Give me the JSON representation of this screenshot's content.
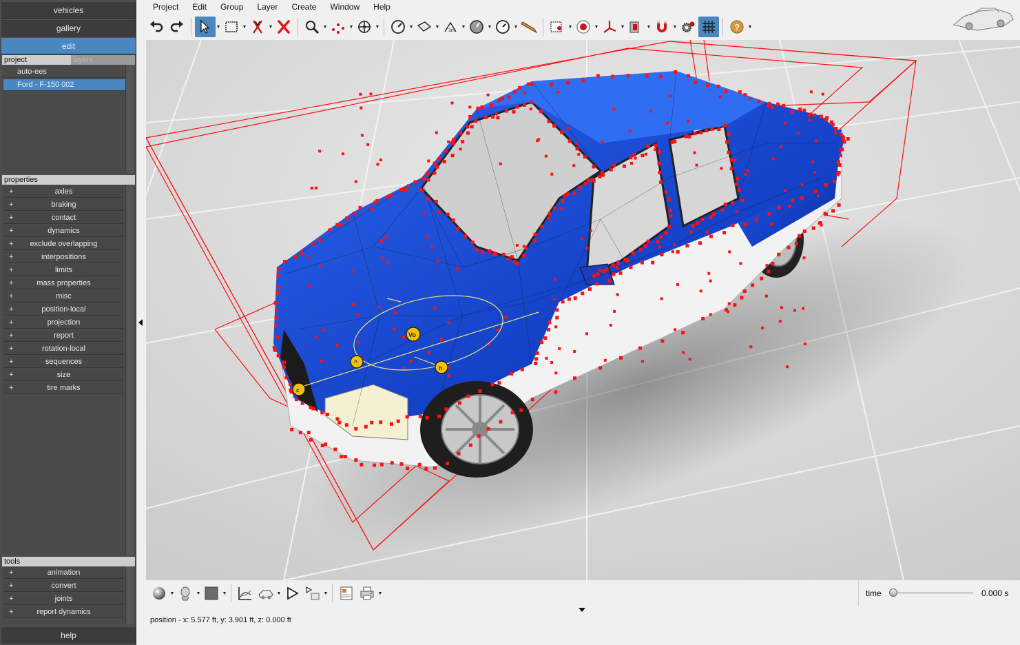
{
  "nav": {
    "vehicles": "vehicles",
    "gallery": "gallery",
    "edit": "edit",
    "help": "help"
  },
  "project_panel": {
    "tab_project": "project",
    "tab_layers": "layers",
    "items": [
      "auto-ees",
      "Ford - F-150 002"
    ],
    "selected_index": 1
  },
  "properties_panel": {
    "title": "properties",
    "items": [
      "axles",
      "braking",
      "contact",
      "dynamics",
      "exclude overlapping",
      "interpositions",
      "limits",
      "mass properties",
      "misc",
      "position-local",
      "projection",
      "report",
      "rotation-local",
      "sequences",
      "size",
      "tire marks"
    ]
  },
  "tools_panel": {
    "title": "tools",
    "items": [
      "animation",
      "convert",
      "joints",
      "report dynamics"
    ]
  },
  "menu": [
    "Project",
    "Edit",
    "Group",
    "Layer",
    "Create",
    "Window",
    "Help"
  ],
  "toolbar_icons": [
    "undo-icon",
    "redo-icon",
    "select-arrow-icon",
    "box-select-icon",
    "cut-icon",
    "delete-icon",
    "zoom-icon",
    "points-icon",
    "move-icon",
    "speed-gauge-icon",
    "surface-icon",
    "measure-icon",
    "dial-icon",
    "clock-icon",
    "pencil-icon",
    "camera-target-icon",
    "record-icon",
    "axes-icon",
    "door-icon",
    "magnet-icon",
    "gears-icon",
    "grid-icon",
    "help-icon"
  ],
  "viewport": {
    "vehicle_color": "#1e4fd8",
    "wire_color": "#ff1010",
    "floor_color": "#d7d7d7"
  },
  "time": {
    "label": "time",
    "value": "0.000 s",
    "position": 0.0
  },
  "status": {
    "text": "position - x: 5.577 ft, y: 3.901 ft, z: 0.000 ft"
  },
  "colors": {
    "accent": "#4a86c0",
    "sidebar": "#4e4e4e",
    "toolbar_bg": "#f0f0f0"
  }
}
